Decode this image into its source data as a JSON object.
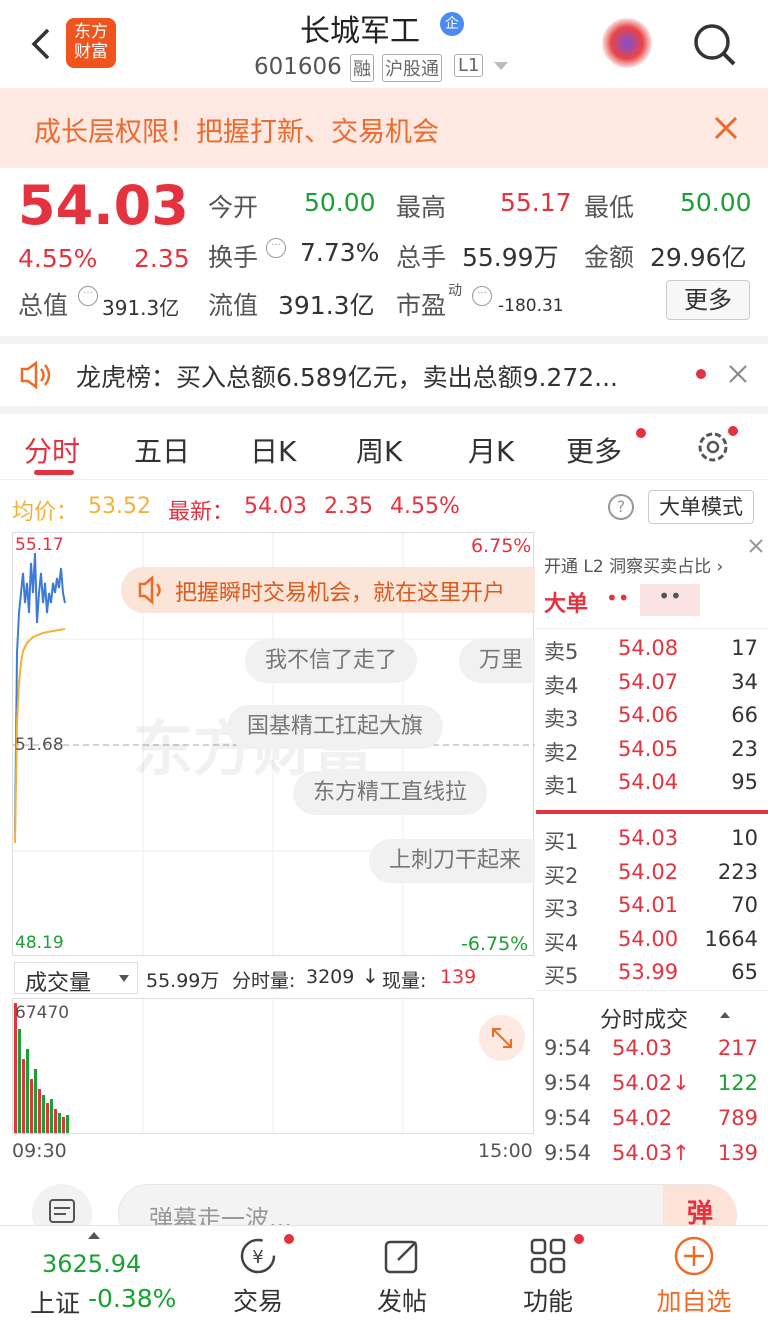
{
  "header": {
    "title": "长城军工",
    "code": "601606",
    "tags": [
      "融",
      "沪股通",
      "L1"
    ],
    "logo": "东方\n财富"
  },
  "banner": {
    "text": "成长层权限！把握打新、交易机会"
  },
  "quote": {
    "price": "54.03",
    "pct": "4.55%",
    "chg": "2.35",
    "open_label": "今开",
    "open": "50.00",
    "high_label": "最高",
    "high": "55.17",
    "low_label": "最低",
    "low": "50.00",
    "turn_label": "换手",
    "turn": "7.73%",
    "vol_label": "总手",
    "vol": "55.99万",
    "amt_label": "金额",
    "amt": "29.96亿",
    "mcap_label": "总值",
    "mcap": "391.3亿",
    "float_label": "流值",
    "float": "391.3亿",
    "pe_label": "市盈",
    "pe_sup": "动",
    "pe": "-180.31",
    "more": "更多"
  },
  "lhb": {
    "text": "龙虎榜：买入总额6.589亿元，卖出总额9.272..."
  },
  "tabs": [
    "分时",
    "五日",
    "日K",
    "周K",
    "月K",
    "更多"
  ],
  "avg": {
    "avg_label": "均价：",
    "avg": "53.52",
    "last_label": "最新：",
    "last": "54.03",
    "chg": "2.35",
    "pct": "4.55%",
    "mode": "大单模式"
  },
  "chart_labels": {
    "top": "55.17",
    "top_pct": "6.75%",
    "mid": "51.68",
    "bottom": "48.19",
    "bottom_pct": "-6.75%",
    "open_time": "09:30",
    "close_time": "15:00",
    "watermark": "东方财富"
  },
  "promo": "把握瞬时交易机会，就在这里开户",
  "danmaku": [
    "我不信了走了",
    "万里",
    "国基精工扛起大旗",
    "东方精工直线拉",
    "上刺刀干起来"
  ],
  "volbar": {
    "label": "成交量",
    "total": "55.99万",
    "fs_label": "分时量:",
    "fs": "3209",
    "cur_label": "现量:",
    "cur": "139",
    "max": "67470"
  },
  "book": {
    "l2": "开通 L2 洞察买卖占比",
    "big": "大单",
    "big_vals": "••",
    "big_vals2": "••",
    "sells": [
      {
        "l": "卖5",
        "p": "54.08",
        "v": "17"
      },
      {
        "l": "卖4",
        "p": "54.07",
        "v": "34"
      },
      {
        "l": "卖3",
        "p": "54.06",
        "v": "66"
      },
      {
        "l": "卖2",
        "p": "54.05",
        "v": "23"
      },
      {
        "l": "卖1",
        "p": "54.04",
        "v": "95"
      }
    ],
    "buys": [
      {
        "l": "买1",
        "p": "54.03",
        "v": "10"
      },
      {
        "l": "买2",
        "p": "54.02",
        "v": "223"
      },
      {
        "l": "买3",
        "p": "54.01",
        "v": "70"
      },
      {
        "l": "买4",
        "p": "54.00",
        "v": "1664"
      },
      {
        "l": "买5",
        "p": "53.99",
        "v": "65"
      }
    ],
    "ticks_title": "分时成交",
    "ticks": [
      {
        "t": "9:54",
        "p": "54.03",
        "v": "217"
      },
      {
        "t": "9:54",
        "p": "54.02↓",
        "v": "122"
      },
      {
        "t": "9:54",
        "p": "54.02",
        "v": "789"
      },
      {
        "t": "9:54",
        "p": "54.03↑",
        "v": "139"
      }
    ]
  },
  "comment": {
    "placeholder": "弹幕走一波...",
    "btn": "弹"
  },
  "bottom": {
    "index_val": "3625.94",
    "index_name": "上证",
    "index_pct": "-0.38%",
    "items": [
      "交易",
      "发帖",
      "功能",
      "加自选"
    ]
  }
}
